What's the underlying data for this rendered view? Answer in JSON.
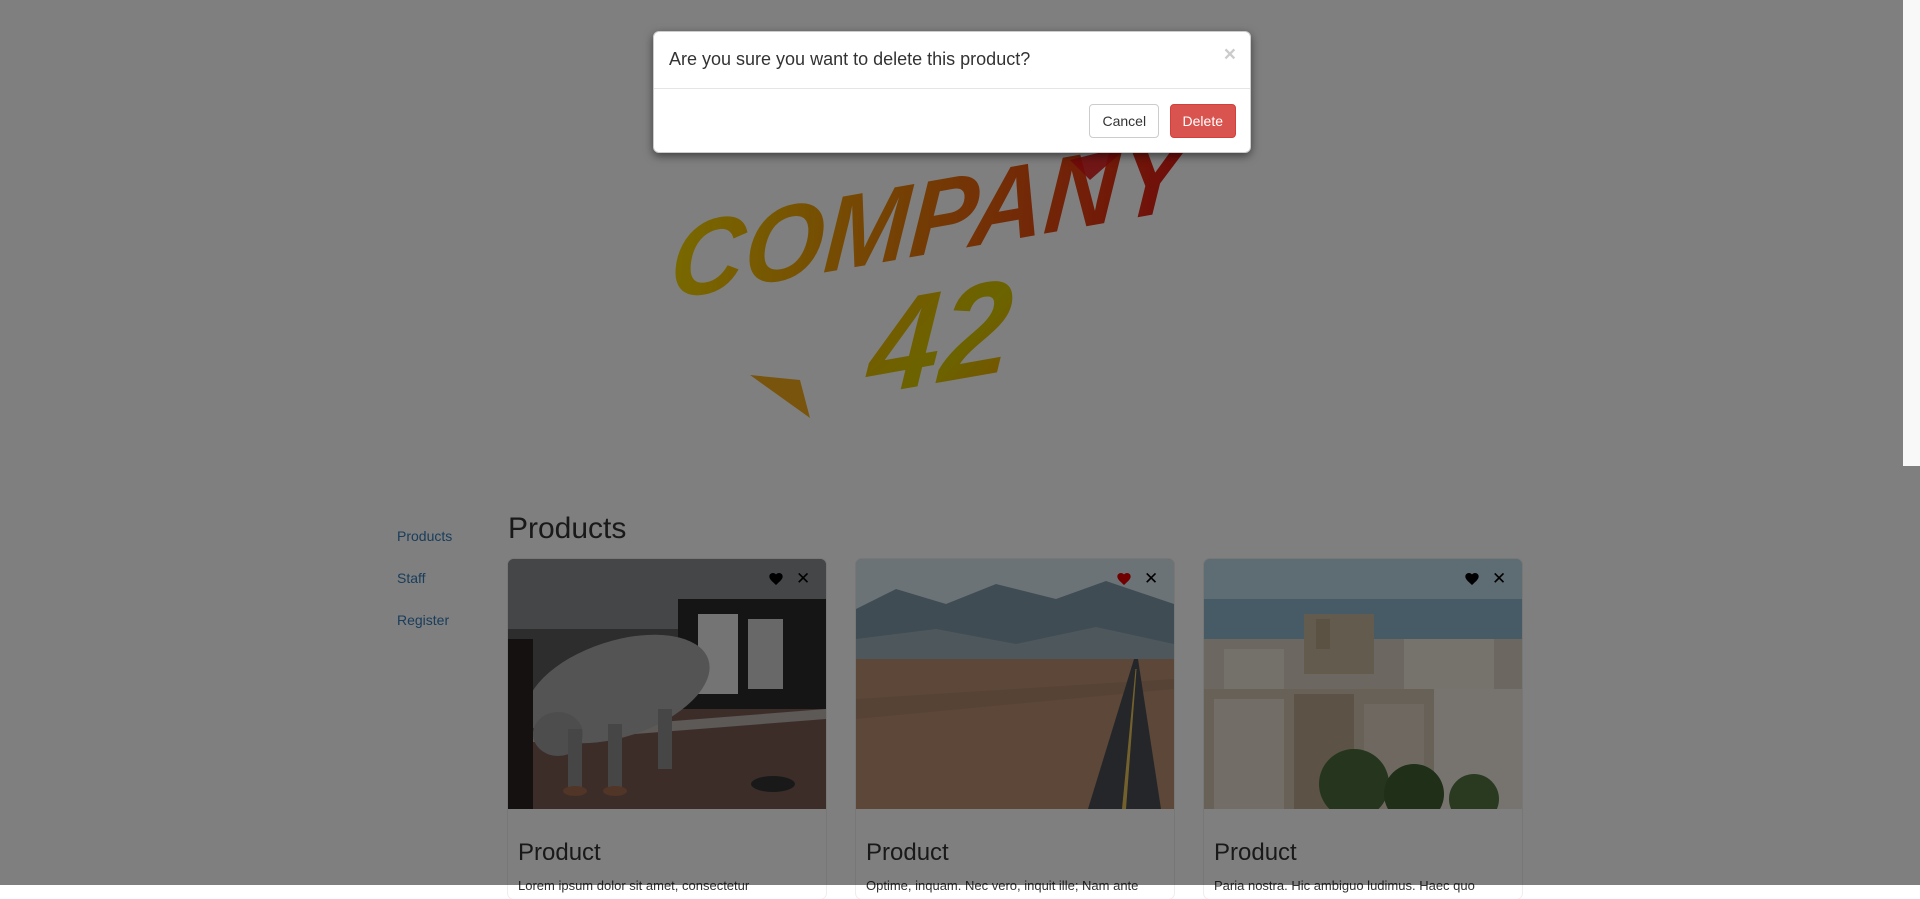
{
  "modal": {
    "title": "Are you sure you want to delete this product?",
    "close_symbol": "×",
    "cancel_label": "Cancel",
    "delete_label": "Delete"
  },
  "logo": {
    "line1": "COMPANY",
    "line2": "42",
    "colors": {
      "start": "#f2d300",
      "end": "#e01515"
    }
  },
  "sidebar": {
    "items": [
      {
        "label": "Products"
      },
      {
        "label": "Staff"
      },
      {
        "label": "Register"
      }
    ]
  },
  "section": {
    "title": "Products"
  },
  "products": [
    {
      "title": "Product",
      "description": "Lorem ipsum dolor sit amet, consectetur",
      "favorite": false,
      "heart_color": "#000000",
      "image": "metal-pig-statue-photo"
    },
    {
      "title": "Product",
      "description": "Optime, inquam. Nec vero, inquit ille; Nam ante",
      "favorite": true,
      "heart_color": "#e00000",
      "image": "desert-road-photo"
    },
    {
      "title": "Product",
      "description": "Paria nostra. Hic ambiguo ludimus. Haec quo",
      "favorite": false,
      "heart_color": "#000000",
      "image": "old-town-city-photo"
    }
  ],
  "colors": {
    "link": "#337ab7",
    "danger": "#d9534f",
    "backdrop": "rgba(0,0,0,0.5)"
  }
}
